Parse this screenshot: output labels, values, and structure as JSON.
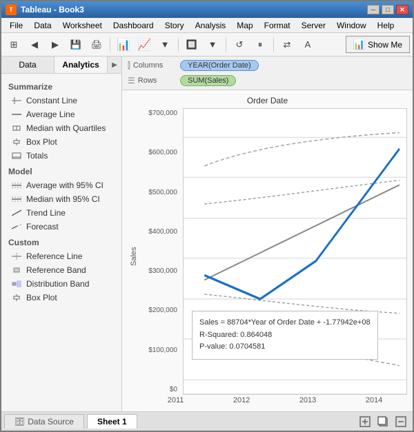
{
  "window": {
    "title": "Tableau - Book3",
    "icon": "T"
  },
  "menu": {
    "items": [
      "File",
      "Data",
      "Worksheet",
      "Dashboard",
      "Story",
      "Analysis",
      "Map",
      "Format",
      "Server",
      "Window",
      "Help"
    ]
  },
  "toolbar": {
    "show_me_label": "Show Me"
  },
  "panel": {
    "tabs": [
      "Data",
      "Analytics"
    ],
    "active_tab": "Analytics",
    "sections": {
      "summarize": {
        "header": "Summarize",
        "items": [
          {
            "label": "Constant Line",
            "icon": "line"
          },
          {
            "label": "Average Line",
            "icon": "line"
          },
          {
            "label": "Median with Quartiles",
            "icon": "median"
          },
          {
            "label": "Box Plot",
            "icon": "box"
          },
          {
            "label": "Totals",
            "icon": "totals"
          }
        ]
      },
      "model": {
        "header": "Model",
        "items": [
          {
            "label": "Average with 95% CI",
            "icon": "ci"
          },
          {
            "label": "Median with 95% CI",
            "icon": "ci"
          },
          {
            "label": "Trend Line",
            "icon": "trend"
          },
          {
            "label": "Forecast",
            "icon": "forecast"
          }
        ]
      },
      "custom": {
        "header": "Custom",
        "items": [
          {
            "label": "Reference Line",
            "icon": "refline"
          },
          {
            "label": "Reference Band",
            "icon": "refband"
          },
          {
            "label": "Distribution Band",
            "icon": "distband"
          },
          {
            "label": "Box Plot",
            "icon": "box"
          }
        ]
      }
    }
  },
  "worksheet": {
    "columns_label": "Columns",
    "rows_label": "Rows",
    "columns_pill": "YEAR(Order Date)",
    "rows_pill": "SUM(Sales)",
    "chart_title": "Order Date",
    "y_axis_label": "Sales",
    "y_labels": [
      "$700,000",
      "$600,000",
      "$500,000",
      "$400,000",
      "$300,000",
      "$200,000",
      "$100,000",
      "$0"
    ],
    "x_labels": [
      "2011",
      "2012",
      "2013",
      "2014"
    ],
    "formula": {
      "line1": "Sales = 88704*Year of Order Date + -1.77942e+08",
      "line2": "R-Squared: 0.864048",
      "line3": "P-value: 0.0704581"
    }
  },
  "bottom_tabs": {
    "data_source_label": "Data Source",
    "sheet_label": "Sheet 1"
  }
}
